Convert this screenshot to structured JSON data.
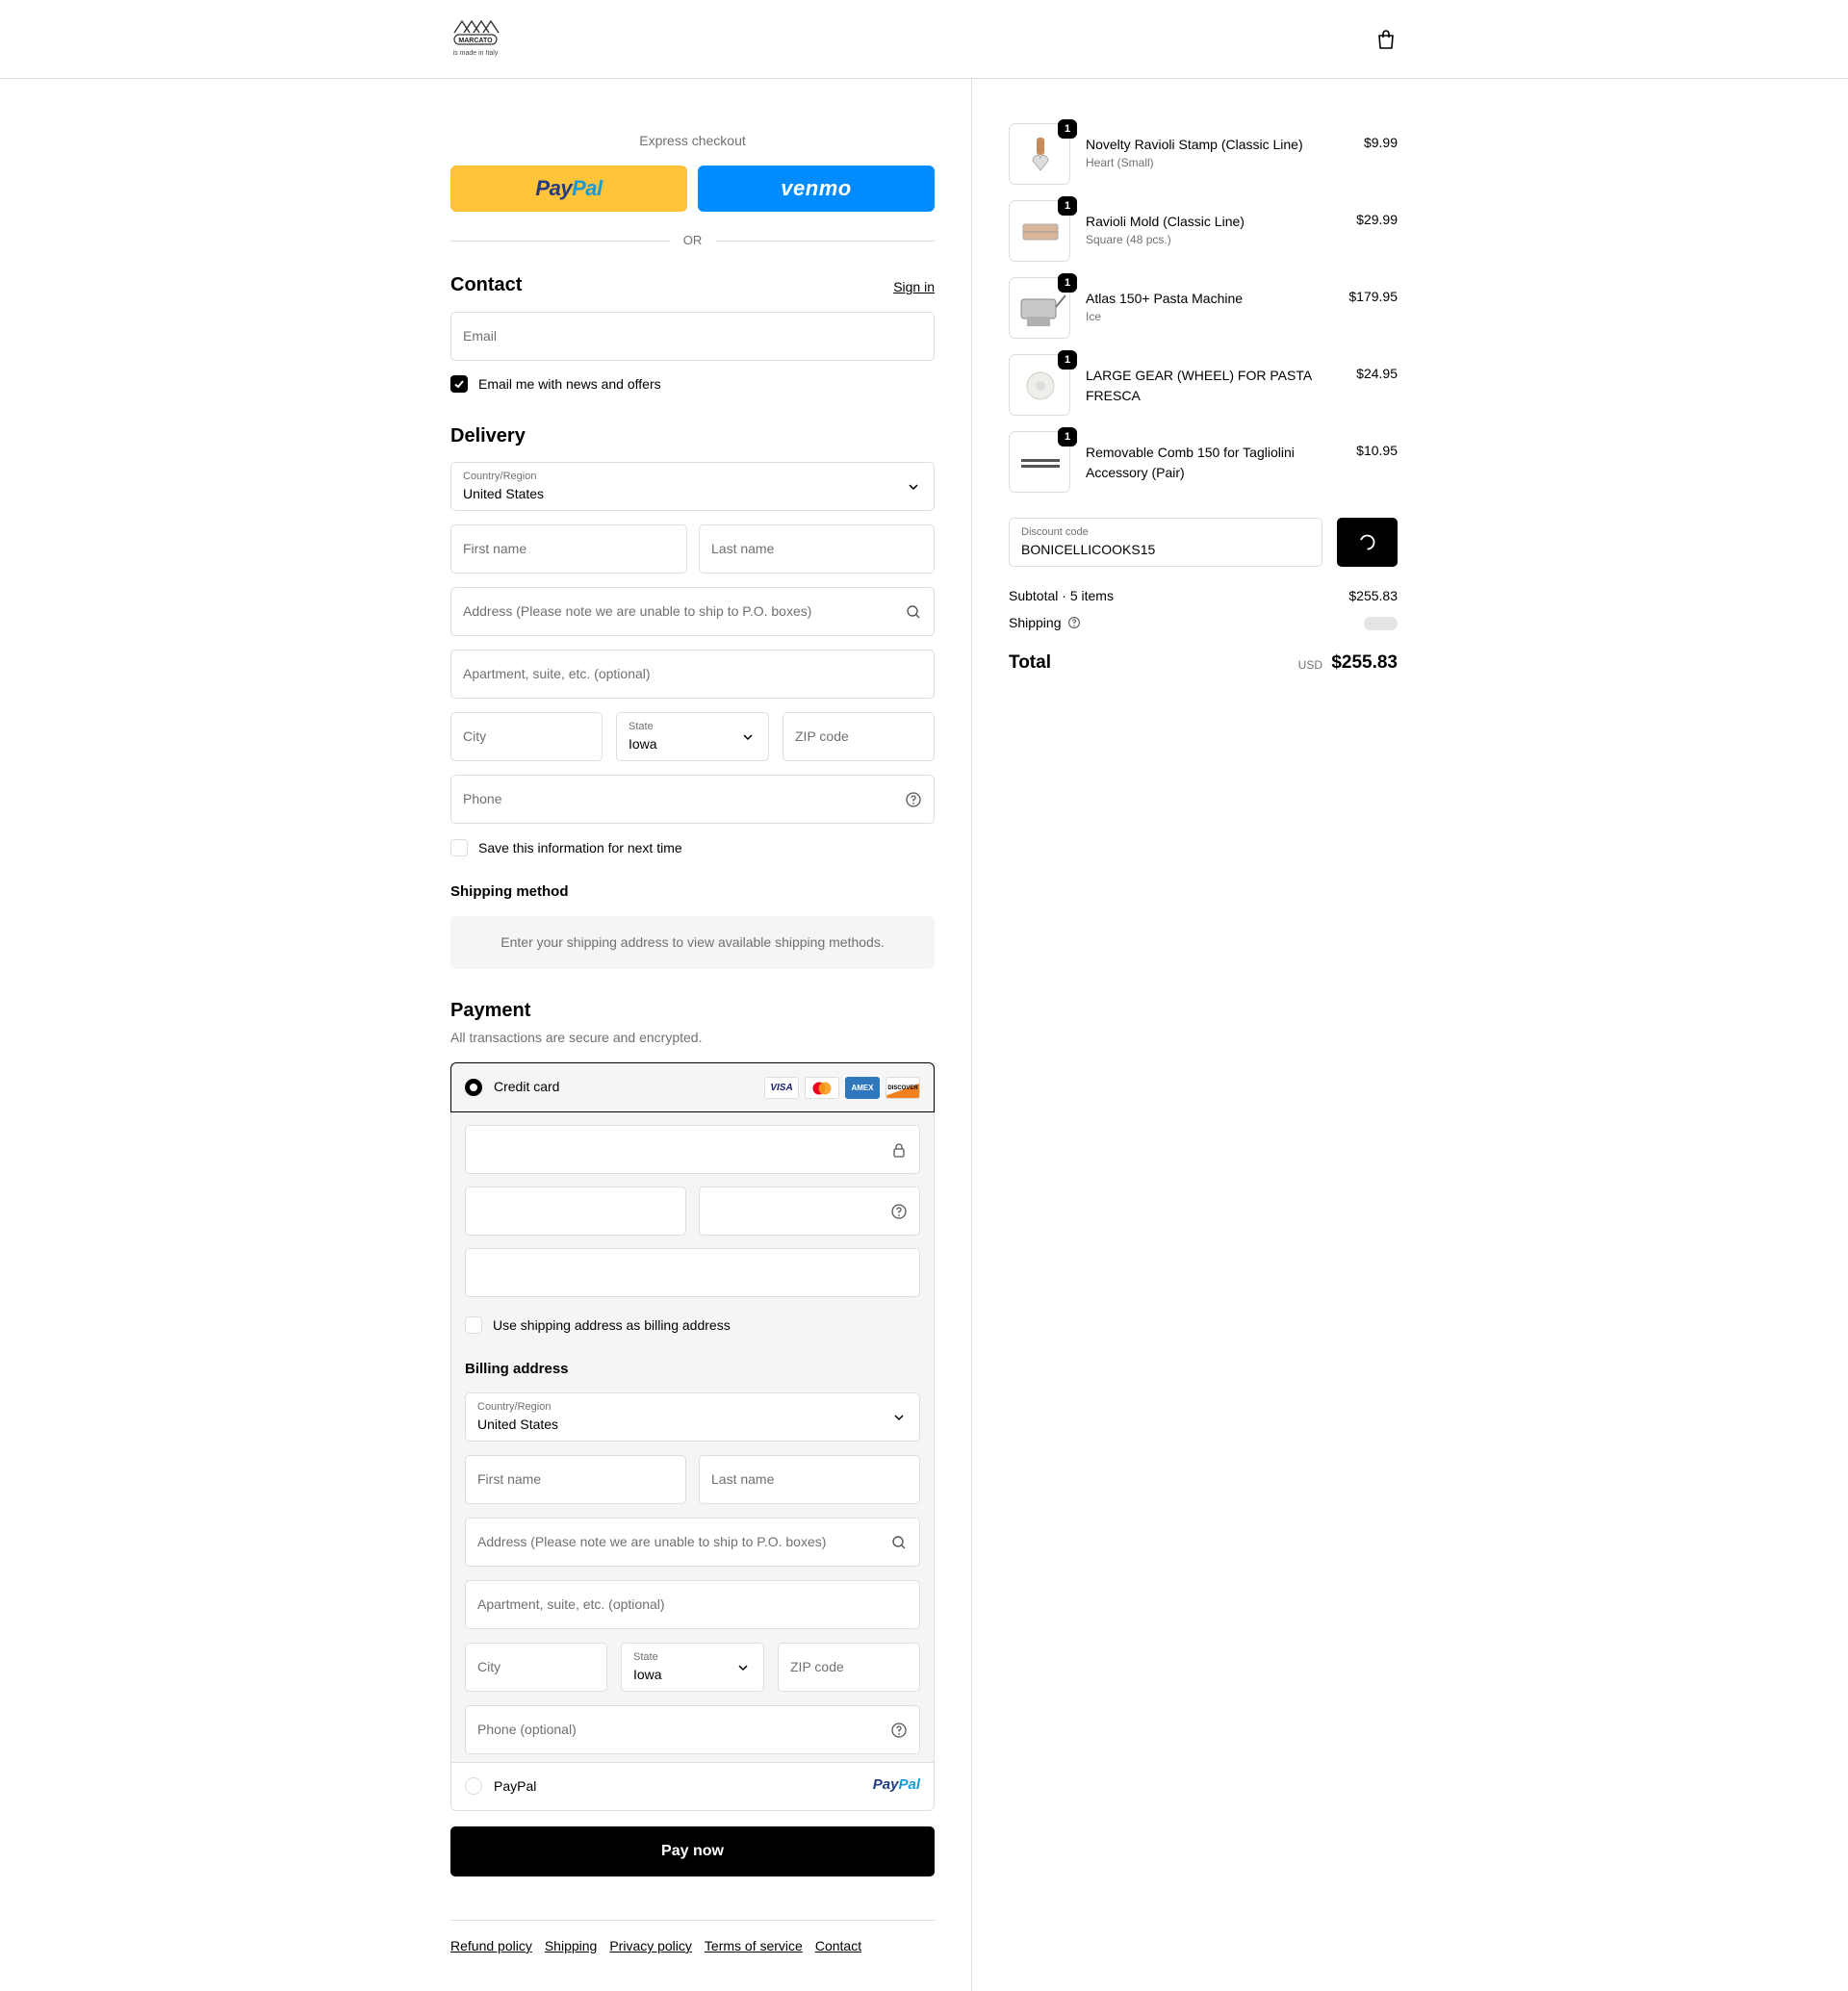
{
  "header": {
    "logo_text": "MARCATO",
    "logo_tagline": "is made in Italy"
  },
  "express": {
    "title": "Express checkout",
    "paypal_a": "Pay",
    "paypal_b": "Pal",
    "venmo": "venmo",
    "or": "OR"
  },
  "contact": {
    "title": "Contact",
    "sign_in": "Sign in",
    "email_placeholder": "Email",
    "news_label": "Email me with news and offers",
    "news_checked": true
  },
  "delivery": {
    "title": "Delivery",
    "country_label": "Country/Region",
    "country_value": "United States",
    "first_name": "First name",
    "last_name": "Last name",
    "address": "Address (Please note we are unable to ship to P.O. boxes)",
    "apartment": "Apartment, suite, etc. (optional)",
    "city": "City",
    "state_label": "State",
    "state_value": "Iowa",
    "zip": "ZIP code",
    "phone": "Phone",
    "save_info": "Save this information for next time"
  },
  "shipping_method": {
    "title": "Shipping method",
    "message": "Enter your shipping address to view available shipping methods."
  },
  "payment": {
    "title": "Payment",
    "note": "All transactions are secure and encrypted.",
    "credit_card_label": "Credit card",
    "card_brands": [
      "VISA",
      "MC",
      "AMEX",
      "DISCOVER"
    ],
    "use_shipping_label": "Use shipping address as billing address",
    "billing_title": "Billing address",
    "billing": {
      "country_label": "Country/Region",
      "country_value": "United States",
      "first_name": "First name",
      "last_name": "Last name",
      "address": "Address (Please note we are unable to ship to P.O. boxes)",
      "apartment": "Apartment, suite, etc. (optional)",
      "city": "City",
      "state_label": "State",
      "state_value": "Iowa",
      "zip": "ZIP code",
      "phone": "Phone (optional)"
    },
    "paypal_label": "PayPal",
    "paypal_logo_a": "Pay",
    "paypal_logo_b": "Pal",
    "pay_now": "Pay now"
  },
  "footer": {
    "links": [
      "Refund policy",
      "Shipping",
      "Privacy policy",
      "Terms of service",
      "Contact"
    ]
  },
  "summary": {
    "items": [
      {
        "qty": "1",
        "name": "Novelty Ravioli Stamp (Classic Line)",
        "variant": "Heart (Small)",
        "price": "$9.99"
      },
      {
        "qty": "1",
        "name": "Ravioli Mold (Classic Line)",
        "variant": "Square (48 pcs.)",
        "price": "$29.99"
      },
      {
        "qty": "1",
        "name": "Atlas 150+ Pasta Machine",
        "variant": "Ice",
        "price": "$179.95"
      },
      {
        "qty": "1",
        "name": "LARGE GEAR (WHEEL) FOR PASTA FRESCA",
        "variant": "",
        "price": "$24.95"
      },
      {
        "qty": "1",
        "name": "Removable Comb 150 for Tagliolini Accessory (Pair)",
        "variant": "",
        "price": "$10.95"
      }
    ],
    "discount_label": "Discount code",
    "discount_value": "BONICELLICOOKS15",
    "subtotal_label": "Subtotal · 5 items",
    "subtotal_value": "$255.83",
    "shipping_label": "Shipping",
    "total_label": "Total",
    "total_currency": "USD",
    "total_value": "$255.83"
  }
}
